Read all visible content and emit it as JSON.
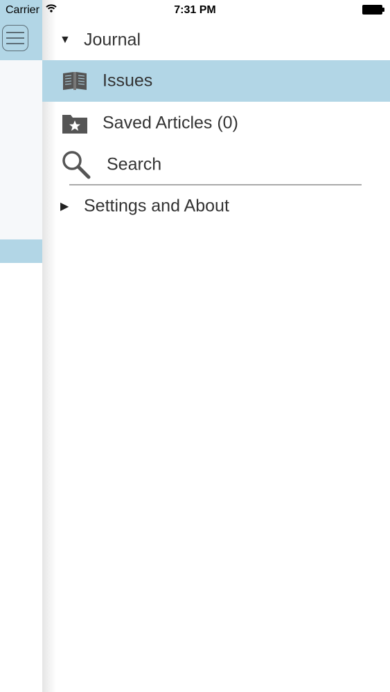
{
  "status_bar": {
    "carrier": "Carrier",
    "time": "7:31 PM"
  },
  "background_app": {
    "menu_icon": "hamburger-menu-icon"
  },
  "drawer": {
    "sections": [
      {
        "label": "Journal",
        "expanded": true
      },
      {
        "label": "Settings and About",
        "expanded": false
      }
    ],
    "items": [
      {
        "label": "Issues",
        "icon": "open-book-icon",
        "selected": true
      },
      {
        "label": "Saved Articles (0)",
        "icon": "folder-star-icon",
        "selected": false
      },
      {
        "label": "Search",
        "icon": "magnifier-icon",
        "selected": false
      }
    ]
  },
  "colors": {
    "selection": "#b2d6e6",
    "text": "#333333",
    "icon": "#555555"
  }
}
